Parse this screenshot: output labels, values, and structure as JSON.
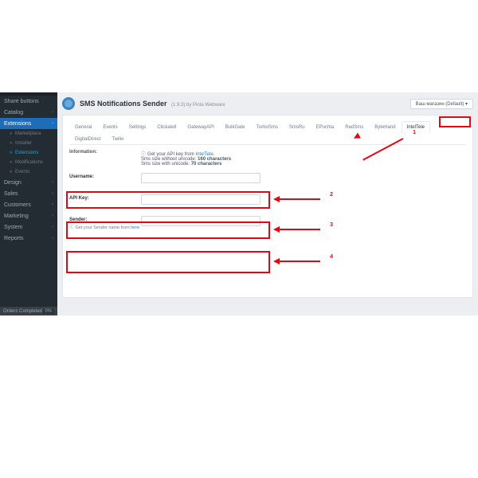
{
  "sidebar": {
    "top": "Share buttons",
    "items": [
      {
        "label": "Catalog"
      },
      {
        "label": "Extensions",
        "active": true
      },
      {
        "label": "Design"
      },
      {
        "label": "Sales"
      },
      {
        "label": "Customers"
      },
      {
        "label": "Marketing"
      },
      {
        "label": "System"
      },
      {
        "label": "Reports"
      }
    ],
    "subs": [
      {
        "label": "Marketplace"
      },
      {
        "label": "Installer"
      },
      {
        "label": "Extensions",
        "selected": true
      },
      {
        "label": "Modifications"
      },
      {
        "label": "Events"
      }
    ],
    "footer": {
      "label": "Orders Completed",
      "count": "0%"
    }
  },
  "header": {
    "title": "SMS Notifications Sender",
    "subtitle": "(1.9.3) by Pinta Webware",
    "store_selector": "Ваш магазин (Default) ▾"
  },
  "tabs_row1": [
    "General",
    "Events",
    "Settings",
    "Clickatell",
    "GatewayAPI",
    "BulkGate",
    "TurboSms",
    "SmsRu",
    "EPochta",
    "RedSms",
    "ByteHand",
    "IntelTele"
  ],
  "tabs_row2": [
    "DigitalDirect",
    "Twilio"
  ],
  "active_tab": "IntelTele",
  "info": {
    "label": "Information:",
    "line1_pre": "Get your API key from ",
    "line1_link": "IntelTele",
    "line2_pre": "Sms size without unicode: ",
    "line2_bold": "160 characters",
    "line3_pre": "Sms size with unicode: ",
    "line3_bold": "70 characters"
  },
  "fields": {
    "username": {
      "label": "Username:"
    },
    "apikey": {
      "label": "API Key:"
    },
    "sender": {
      "label": "Sender:",
      "hint_pre": "Get your Sender name from ",
      "hint_link": "here"
    }
  },
  "annotations": [
    "1",
    "2",
    "3",
    "4"
  ]
}
